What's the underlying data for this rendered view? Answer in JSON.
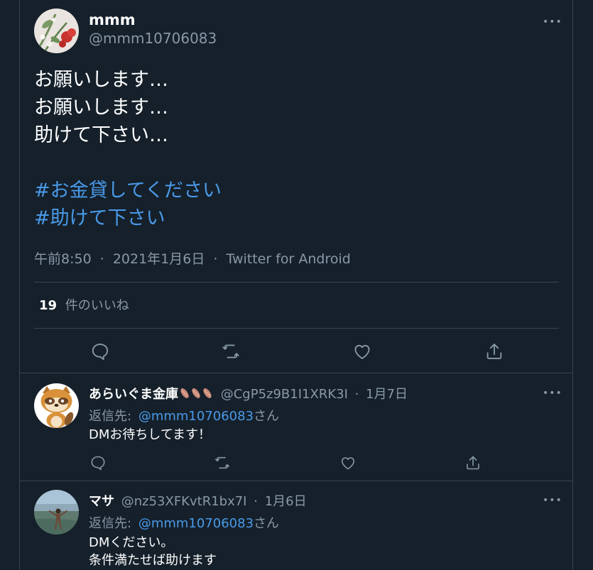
{
  "main_tweet": {
    "name": "mmm",
    "handle": "@mmm10706083",
    "body_lines": [
      "お願いします…",
      "お願いします…",
      "助けて下さい…"
    ],
    "hashtags": [
      "#お金貸してください",
      "#助けて下さい"
    ],
    "time": "午前8:50",
    "separator": "·",
    "date": "2021年1月6日",
    "via": "Twitter for Android",
    "likes_count": "19",
    "likes_label": "件のいいね",
    "more_label": "•••"
  },
  "replies": [
    {
      "name": "あらいぐま金庫",
      "name_emoji": [
        "sausage-emoji",
        "sausage-emoji",
        "sausage-emoji"
      ],
      "handle": "@CgP5z9B1I1XRK3I",
      "separator": "·",
      "date": "1月7日",
      "reply_to_prefix": "返信先:",
      "reply_to_mention": "@mmm10706083",
      "reply_to_suffix": "さん",
      "text_lines": [
        "DMお待ちしてます！"
      ],
      "more_label": "•••"
    },
    {
      "name": "マサ",
      "handle": "@nz53XFKvtR1bx7I",
      "separator": "·",
      "date": "1月6日",
      "reply_to_prefix": "返信先:",
      "reply_to_mention": "@mmm10706083",
      "reply_to_suffix": "さん",
      "text_lines": [
        "DMください。",
        "条件満たせば助けます"
      ],
      "more_label": "•••"
    }
  ],
  "icons": {
    "reply": "reply-icon",
    "retweet": "retweet-icon",
    "like": "heart-icon",
    "share": "share-icon",
    "more": "more-icon"
  },
  "colors": {
    "background": "#15202b",
    "border": "#38444d",
    "secondary_text": "#8899a6",
    "link": "#4a9ae8",
    "primary_text": "#ffffff"
  }
}
